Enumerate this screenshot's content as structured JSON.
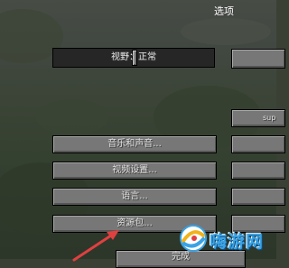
{
  "screen": {
    "title": "选项"
  },
  "fov_slider": {
    "label": "视野：正常",
    "value": 0.5
  },
  "buttons": {
    "music_sounds": "音乐和声音...",
    "video_settings": "视频设置...",
    "language": "语言...",
    "resource_packs": "资源包...",
    "done": "完成"
  },
  "right_column": {
    "partial_label": "sup"
  },
  "watermark": {
    "text": "嗨游网"
  },
  "colors": {
    "button_face": "#777777",
    "slider_face": "#262626",
    "text": "#e0e0e0",
    "arrow": "#e04040",
    "watermark_blue": "#3aa3e4"
  }
}
